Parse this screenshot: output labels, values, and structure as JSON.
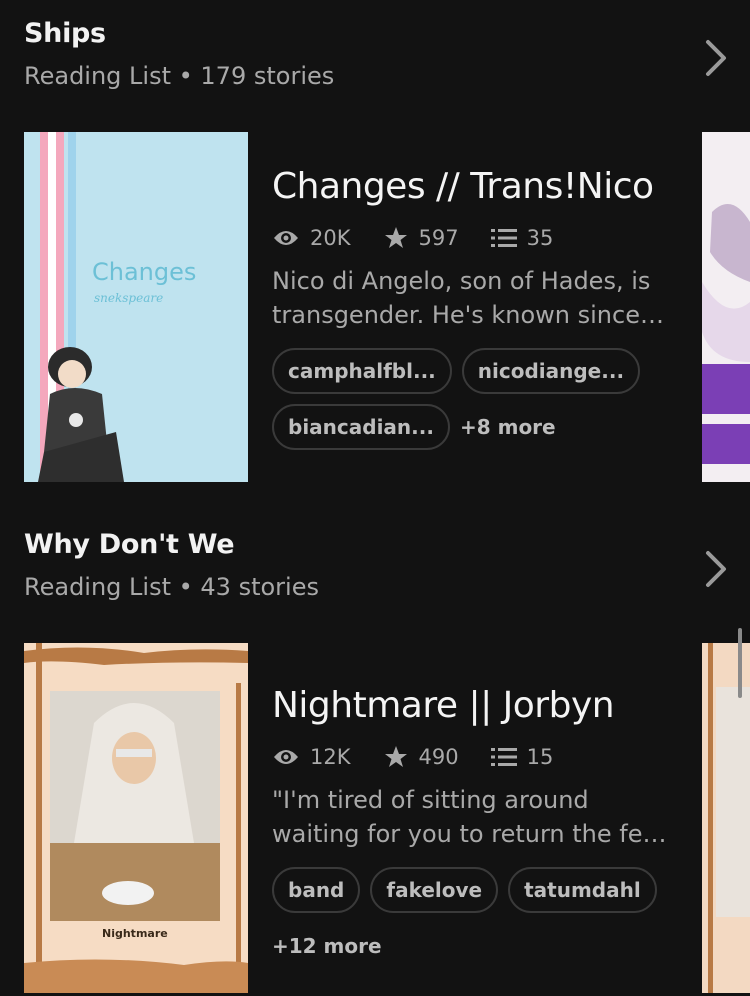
{
  "lists": [
    {
      "title": "Ships",
      "subtitle": "Reading List • 179 stories",
      "story": {
        "title": "Changes // Trans!Nico",
        "cover_title": "Changes",
        "cover_author": "snekspeare",
        "views": "20K",
        "votes": "597",
        "parts": "35",
        "desc_line1": "Nico di Angelo, son of Hades, is",
        "desc_line2": "transgender. He's known since…",
        "tags": [
          "camphalfbl...",
          "nicodiange...",
          "biancadian..."
        ],
        "more": "+8 more"
      }
    },
    {
      "title": "Why Don't We",
      "subtitle": "Reading List • 43 stories",
      "story": {
        "title": "Nightmare || Jorbyn",
        "cover_title": "Nightmare",
        "views": "12K",
        "votes": "490",
        "parts": "15",
        "desc_line1": "\"I'm tired of sitting around",
        "desc_line2": "waiting for you to return the fe…",
        "tags": [
          "band",
          "fakelove",
          "tatumdahl"
        ],
        "more": "+12 more"
      }
    }
  ]
}
